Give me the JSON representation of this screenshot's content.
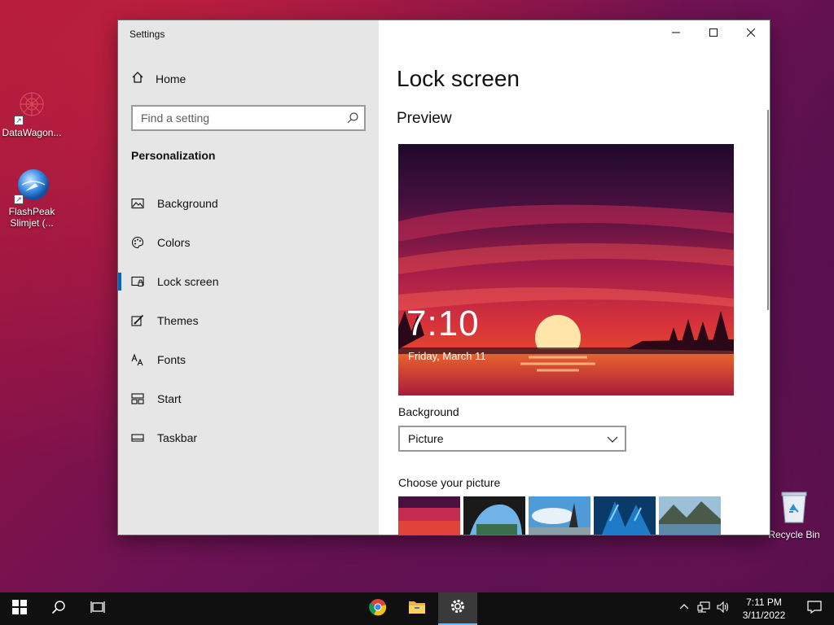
{
  "desktop": {
    "icons": [
      {
        "label": "DataWagon...",
        "icon": "datawagon-icon"
      },
      {
        "label": "FlashPeak Slimjet (...",
        "icon": "flashpeak-slimjet-icon"
      },
      {
        "label": "Recycle Bin",
        "icon": "recycle-bin-icon"
      }
    ]
  },
  "window": {
    "app_title": "Settings",
    "controls": [
      "minimize-icon",
      "maximize-icon",
      "close-icon"
    ]
  },
  "sidebar": {
    "home_label": "Home",
    "search": {
      "placeholder": "Find a setting",
      "value": ""
    },
    "section_title": "Personalization",
    "items": [
      {
        "label": "Background",
        "icon": "picture-icon"
      },
      {
        "label": "Colors",
        "icon": "palette-icon"
      },
      {
        "label": "Lock screen",
        "icon": "lock-screen-icon",
        "active": true
      },
      {
        "label": "Themes",
        "icon": "brush-icon"
      },
      {
        "label": "Fonts",
        "icon": "fonts-icon"
      },
      {
        "label": "Start",
        "icon": "start-tiles-icon"
      },
      {
        "label": "Taskbar",
        "icon": "taskbar-icon"
      }
    ]
  },
  "content": {
    "page_title": "Lock screen",
    "preview_title": "Preview",
    "preview_time": "7:10",
    "preview_date": "Friday, March 11",
    "background_label": "Background",
    "background_value": "Picture",
    "choose_label": "Choose your picture",
    "thumbnails": [
      "sunset-lake",
      "cave-beach",
      "rock-sky",
      "underwater-ice",
      "mountain-lake"
    ]
  },
  "taskbar": {
    "buttons": [
      "windows-start-icon",
      "search-icon",
      "task-view-icon",
      "chrome-icon",
      "file-explorer-icon",
      "settings-icon"
    ],
    "clock_time": "7:11 PM",
    "clock_date": "3/11/2022",
    "tray": [
      "chevron-up-icon",
      "network-icon",
      "volume-icon",
      "notifications-icon"
    ]
  },
  "colors": {
    "accent": "#0067c0",
    "sidebar_bg": "#e6e6e6",
    "taskbar_bg": "#101010"
  }
}
